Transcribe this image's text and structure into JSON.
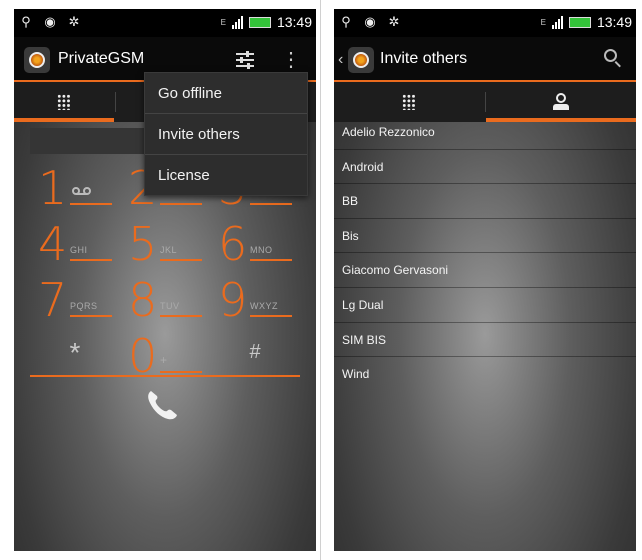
{
  "status_bar": {
    "time": "13:49",
    "network_label": "E"
  },
  "left_screen": {
    "app_title": "PrivateGSM",
    "overflow_menu": [
      "Go offline",
      "Invite others",
      "License"
    ],
    "dialpad": [
      {
        "digit": "1",
        "letters": "",
        "icon": "voicemail-icon"
      },
      {
        "digit": "2",
        "letters": ""
      },
      {
        "digit": "3",
        "letters": ""
      },
      {
        "digit": "4",
        "letters": "GHI"
      },
      {
        "digit": "5",
        "letters": "JKL"
      },
      {
        "digit": "6",
        "letters": "MNO"
      },
      {
        "digit": "7",
        "letters": "PQRS"
      },
      {
        "digit": "8",
        "letters": "TUV"
      },
      {
        "digit": "9",
        "letters": "WXYZ"
      },
      {
        "digit": "*",
        "letters": ""
      },
      {
        "digit": "0",
        "letters": "+"
      },
      {
        "digit": "#",
        "letters": ""
      }
    ]
  },
  "right_screen": {
    "title": "Invite others",
    "contacts": [
      "Adelio Rezzonico",
      "Android",
      "BB",
      "Bis",
      "Giacomo Gervasoni",
      "Lg Dual",
      "SIM BIS",
      "Wind"
    ]
  },
  "colors": {
    "accent": "#ea6b1e",
    "bar": "#0a0a0a",
    "tab_bg": "#1d1d1d"
  },
  "icons": [
    "usb-icon",
    "app-notify-icon",
    "android-debug-icon",
    "signal-icon",
    "battery-icon",
    "settings-sliders-icon",
    "overflow-menu-icon",
    "dialpad-icon",
    "contacts-icon",
    "search-icon",
    "phone-call-icon",
    "back-icon"
  ]
}
